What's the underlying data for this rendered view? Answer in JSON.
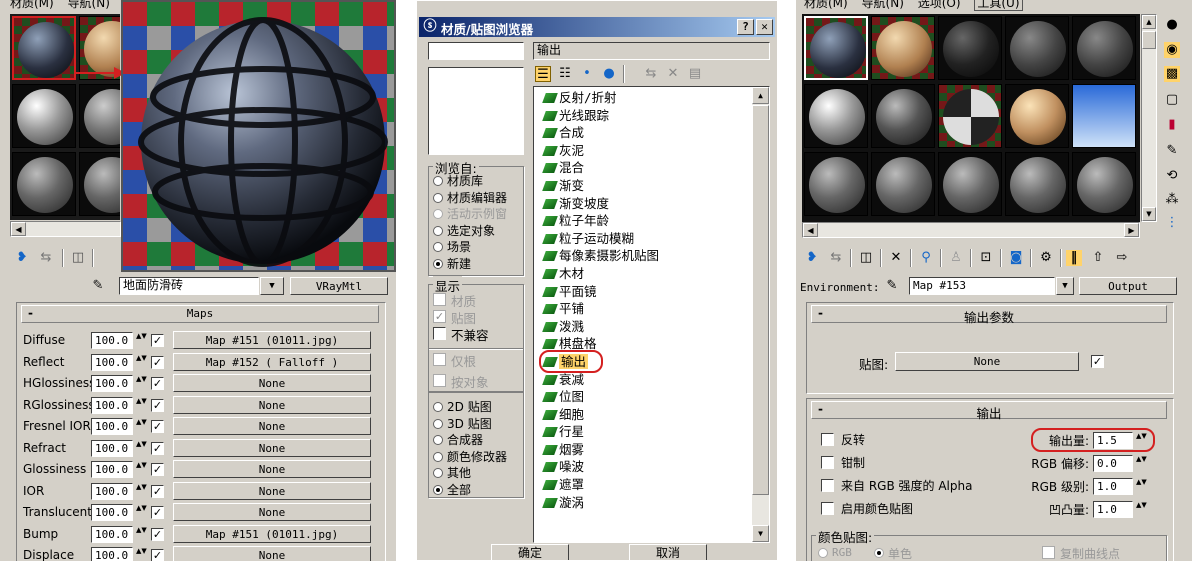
{
  "left": {
    "menu": [
      "材质(M)",
      "导航(N)"
    ],
    "material_name": "地面防滑砖",
    "material_type": "VRayMtl",
    "maps_title": "Maps",
    "maps": [
      {
        "label": "Diffuse",
        "amount": "100.0",
        "checked": true,
        "map": "Map #151 (01011.jpg)"
      },
      {
        "label": "Reflect",
        "amount": "100.0",
        "checked": true,
        "map": "Map #152  ( Falloff )"
      },
      {
        "label": "HGlossiness",
        "amount": "100.0",
        "checked": true,
        "map": "None"
      },
      {
        "label": "RGlossiness",
        "amount": "100.0",
        "checked": true,
        "map": "None"
      },
      {
        "label": "Fresnel IOR",
        "amount": "100.0",
        "checked": true,
        "map": "None"
      },
      {
        "label": "Refract",
        "amount": "100.0",
        "checked": true,
        "map": "None"
      },
      {
        "label": "Glossiness",
        "amount": "100.0",
        "checked": true,
        "map": "None"
      },
      {
        "label": "IOR",
        "amount": "100.0",
        "checked": true,
        "map": "None"
      },
      {
        "label": "Translucent",
        "amount": "100.0",
        "checked": true,
        "map": "None"
      },
      {
        "label": "Bump",
        "amount": "100.0",
        "checked": true,
        "map": "Map #151 (01011.jpg)"
      },
      {
        "label": "Displace",
        "amount": "100.0",
        "checked": true,
        "map": "None"
      }
    ],
    "rollout_minus": "-"
  },
  "browser": {
    "title": "材质/贴图浏览器",
    "help": "?",
    "close": "✕",
    "name_field": "输出",
    "browse_from_title": "浏览自:",
    "browse_from": [
      {
        "label": "材质库",
        "selected": false,
        "enabled": true
      },
      {
        "label": "材质编辑器",
        "selected": false,
        "enabled": true
      },
      {
        "label": "活动示例窗",
        "selected": false,
        "enabled": false
      },
      {
        "label": "选定对象",
        "selected": false,
        "enabled": true
      },
      {
        "label": "场景",
        "selected": false,
        "enabled": true
      },
      {
        "label": "新建",
        "selected": true,
        "enabled": true
      }
    ],
    "show_title": "显示",
    "show": [
      {
        "label": "材质",
        "checked": false,
        "enabled": false
      },
      {
        "label": "贴图",
        "checked": true,
        "enabled": false
      },
      {
        "label": "不兼容",
        "checked": false,
        "enabled": true
      }
    ],
    "filter": [
      {
        "label": "仅根",
        "checked": false
      },
      {
        "label": "按对象",
        "checked": false
      }
    ],
    "types": [
      {
        "label": "2D 贴图",
        "selected": false
      },
      {
        "label": "3D 贴图",
        "selected": false
      },
      {
        "label": "合成器",
        "selected": false
      },
      {
        "label": "颜色修改器",
        "selected": false
      },
      {
        "label": "其他",
        "selected": false
      },
      {
        "label": "全部",
        "selected": true
      }
    ],
    "items": [
      "反射/折射",
      "光线跟踪",
      "合成",
      "灰泥",
      "混合",
      "渐变",
      "渐变坡度",
      "粒子年龄",
      "粒子运动模糊",
      "每像素摄影机贴图",
      "木材",
      "平面镜",
      "平铺",
      "泼溅",
      "棋盘格",
      "输出",
      "衰减",
      "位图",
      "细胞",
      "行星",
      "烟雾",
      "噪波",
      "遮罩",
      "漩涡"
    ],
    "selected_item": "输出",
    "ok": "确定",
    "cancel": "取消"
  },
  "right": {
    "menu": [
      "材质(M)",
      "导航(N)",
      "选项(O)",
      "工具(U)"
    ],
    "env_label": "Environment:",
    "map_name": "Map #153",
    "map_type": "Output",
    "output_params_title": "输出参数",
    "map_label": "贴图:",
    "map_value": "None",
    "map_checked": true,
    "output_title": "输出",
    "checks": [
      "反转",
      "钳制",
      "来自 RGB 强度的 Alpha",
      "启用颜色贴图"
    ],
    "params": [
      {
        "label": "输出量:",
        "value": "1.5"
      },
      {
        "label": "RGB 偏移:",
        "value": "0.0"
      },
      {
        "label": "RGB 级别:",
        "value": "1.0"
      },
      {
        "label": "凹凸量:",
        "value": "1.0"
      }
    ],
    "color_map_title": "颜色贴图:",
    "color_map_opts": [
      {
        "label": "RGB",
        "selected": false
      },
      {
        "label": "单色",
        "selected": true
      }
    ],
    "copy_curve": "复制曲线点",
    "rollout_minus": "-"
  },
  "colors": {
    "panel_bg": "#d4d0c8",
    "highlight_red": "#d42020",
    "selected_item_bg": "#ffd36a"
  }
}
